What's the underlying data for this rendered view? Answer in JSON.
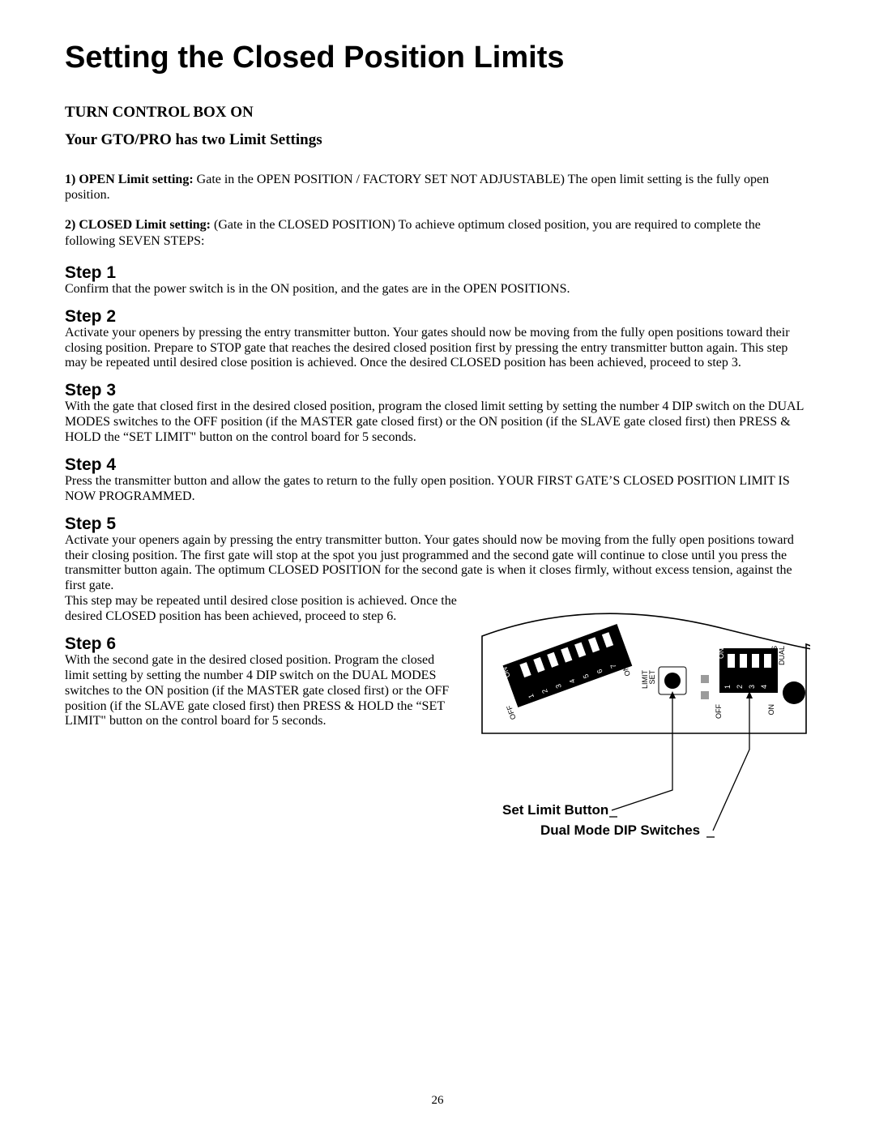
{
  "title": "Setting the Closed Position Limits",
  "sub1": "TURN CONTROL BOX ON",
  "sub2": "Your GTO/PRO has two Limit Settings",
  "open_limit_lead": "1) OPEN Limit setting: ",
  "open_limit_body": "Gate in the OPEN POSITION / FACTORY SET  NOT ADJUSTABLE)  The open limit setting is the fully open position.",
  "closed_limit_lead": "2) CLOSED Limit setting: ",
  "closed_limit_body": "(Gate in the CLOSED POSITION)  To achieve optimum closed position, you are required to complete the following SEVEN STEPS:",
  "steps": {
    "s1h": "Step 1",
    "s1p": "Confirm that the power switch is in the ON position, and the gates are in the OPEN POSITIONS.",
    "s2h": "Step 2",
    "s2p": "Activate your openers by pressing the entry transmitter button. Your gates should now be moving from the fully open positions toward their closing position. Prepare to STOP gate that reaches the desired closed position first by pressing the entry transmitter button again. This step may be repeated until desired close position is achieved.  Once the desired CLOSED position has been achieved, proceed to step 3.",
    "s3h": "Step 3",
    "s3p": "With the gate that closed first in the desired closed position, program the closed limit setting by setting the number 4 DIP switch on the DUAL MODES switches to the OFF position (if the MASTER gate closed first) or the ON position (if the SLAVE gate closed first) then PRESS & HOLD the “SET LIMIT\" button on the control board for 5 seconds.",
    "s4h": "Step 4",
    "s4p": "Press the transmitter button and allow the gates to return to the fully open position. YOUR FIRST GATE’S CLOSED POSITION LIMIT IS NOW PROGRAMMED.",
    "s5h": "Step 5",
    "s5a": "Activate your openers again by pressing the entry transmitter button. Your gates should now be moving from the fully open positions toward their closing position. The first gate will stop at the spot you just programmed and the second gate will continue to close until you press the transmitter button again. The optimum CLOSED POSITION for the second gate is when it closes firmly, without excess tension, against the first gate.",
    "s5b": "This step may be repeated until desired close position is achieved. Once the desired CLOSED position has been achieved, proceed to step 6.",
    "s6h": "Step 6",
    "s6p": "With the second gate in the desired closed position. Program the closed limit setting by setting the number 4 DIP switch on the DUAL MODES switches to the ON position (if the MASTER gate closed first) or the OFF position (if the SLAVE gate closed first) then PRESS & HOLD the “SET LIMIT\" button on the control board for 5 seconds."
  },
  "diagram": {
    "callout1": "Set Limit Button",
    "callout2": "Dual Mode DIP Switches",
    "left_dip_on": "ON",
    "left_dip_off": "OFF",
    "left_dip_on2": "ON",
    "left_dip_1": "1",
    "left_dip_2": "2",
    "left_dip_3": "3",
    "left_dip_4": "4",
    "left_dip_5": "5",
    "left_dip_6": "6",
    "left_dip_7": "7",
    "right_dip_on": "ON",
    "right_dip_off": "OFF",
    "right_dip_on2": "ON",
    "right_dip_1": "1",
    "right_dip_2": "2",
    "right_dip_3": "3",
    "right_dip_4": "4",
    "set_limit_lbl1": "SET",
    "set_limit_lbl2": "LIMIT",
    "dual_modes_lbl1": "DUAL",
    "dual_modes_lbl2": "MODES"
  },
  "page_number": "26"
}
